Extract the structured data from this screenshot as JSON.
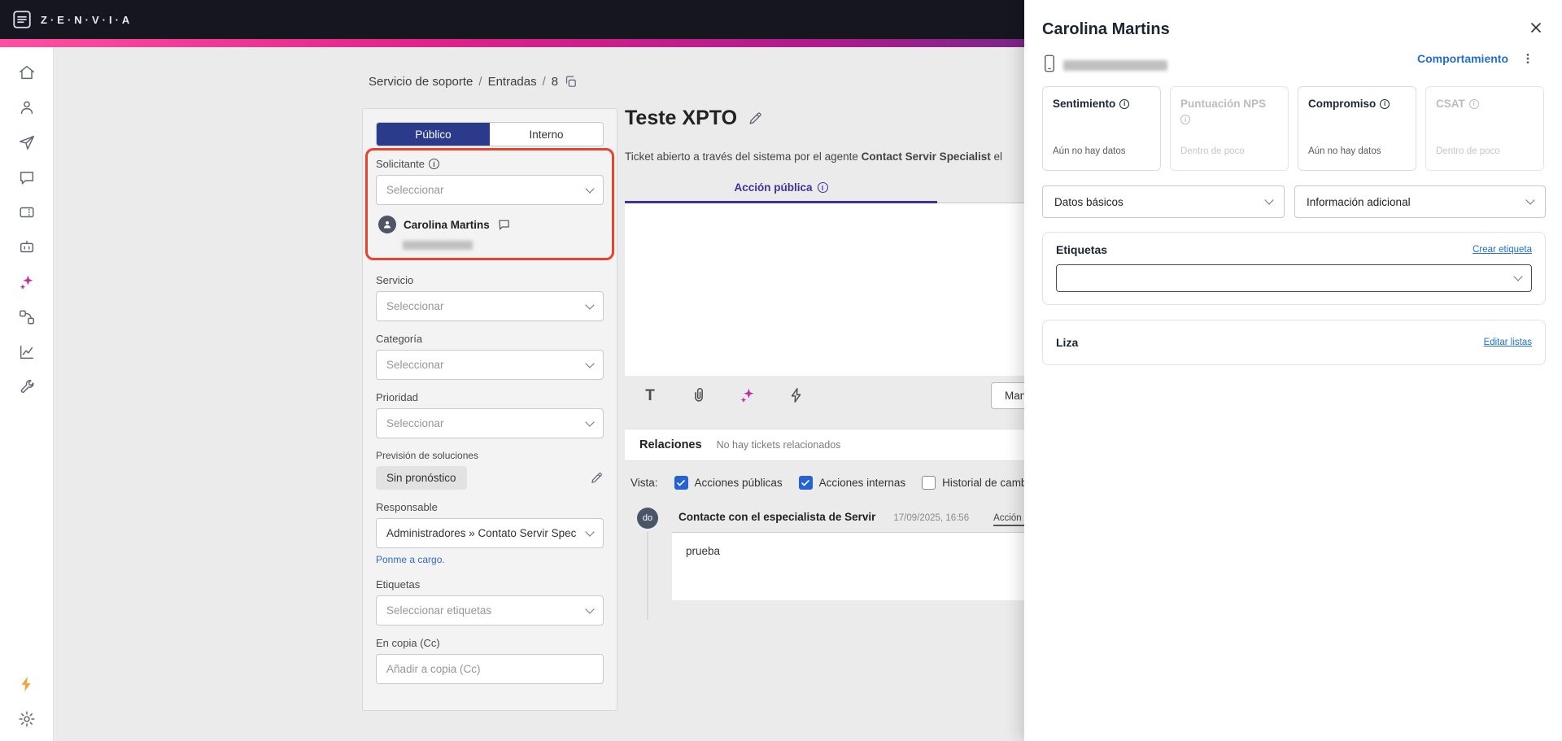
{
  "colors": {
    "topbar": "#16161f",
    "magenta": "#d5218f",
    "accent_purple": "#43309c",
    "tab_navy": "#2c3a8c",
    "link_blue": "#1f6ed4",
    "annotation_red": "#e8432e",
    "checkbox_blue": "#2463d1"
  },
  "topbar": {
    "brand": "Z·E·N·V·I·A"
  },
  "sidebar": {
    "icons": [
      "home",
      "contacts",
      "send",
      "chat",
      "tickets",
      "workspace",
      "ai-sparkles",
      "integrations",
      "analytics",
      "tools",
      "flash",
      "settings"
    ]
  },
  "breadcrumb": {
    "separator": "/",
    "path": [
      "Servicio de soporte",
      "Entradas",
      "8"
    ]
  },
  "form": {
    "tab_publico": "Público",
    "tab_interno": "Interno",
    "solicitante_label": "Solicitante",
    "solicitante_placeholder": "Seleccionar",
    "solicitante_selected": "Carolina Martins",
    "servicio_label": "Servicio",
    "servicio_placeholder": "Seleccionar",
    "categoria_label": "Categoría",
    "categoria_placeholder": "Seleccionar",
    "prioridad_label": "Prioridad",
    "prioridad_placeholder": "Seleccionar",
    "prevision_label": "Previsión de soluciones",
    "prevision_value": "Sin pronóstico",
    "responsable_label": "Responsable",
    "responsable_value": "Administradores » Contato Servir Spec",
    "assign_me_link": "Ponme a cargo.",
    "etiquetas_label": "Etiquetas",
    "etiquetas_placeholder": "Seleccionar etiquetas",
    "cc_label": "En copia (Cc)",
    "cc_placeholder": "Añadir a copia (Cc)"
  },
  "ticket": {
    "title": "Teste XPTO",
    "opened_prefix": "Ticket abierto a través del sistema por el agente ",
    "opened_agent": "Contact Servir Specialist",
    "opened_suffix": " el",
    "tab_accion_publica": "Acción pública",
    "send_button": "Man",
    "relaciones_title": "Relaciones",
    "relaciones_empty": "No hay tickets relacionados",
    "vista_label": "Vista:",
    "vista_options": [
      {
        "label": "Acciones públicas",
        "checked": true
      },
      {
        "label": "Acciones internas",
        "checked": true
      },
      {
        "label": "Historial de cambi",
        "checked": false
      }
    ],
    "entry": {
      "avatar": "do",
      "author": "Contacte con el especialista de Servir",
      "timestamp": "17/09/2025, 16:56",
      "type_label": "Acción púb",
      "body": "prueba"
    }
  },
  "drawer": {
    "title": "Carolina Martins",
    "behavior_link": "Comportamiento",
    "metrics": [
      {
        "label": "Sentimiento",
        "value": "Aún no hay datos",
        "disabled": false
      },
      {
        "label": "Puntuación NPS",
        "value": "Dentro de poco",
        "disabled": true
      },
      {
        "label": "Compromiso",
        "value": "Aún no hay datos",
        "disabled": false
      },
      {
        "label": "CSAT",
        "value": "Dentro de poco",
        "disabled": true
      }
    ],
    "accordion_basic": "Datos básicos",
    "accordion_additional": "Información adicional",
    "etiquetas_title": "Etiquetas",
    "etiquetas_link": "Crear etiqueta",
    "listas_title": "Liza",
    "listas_link": "Editar listas"
  }
}
